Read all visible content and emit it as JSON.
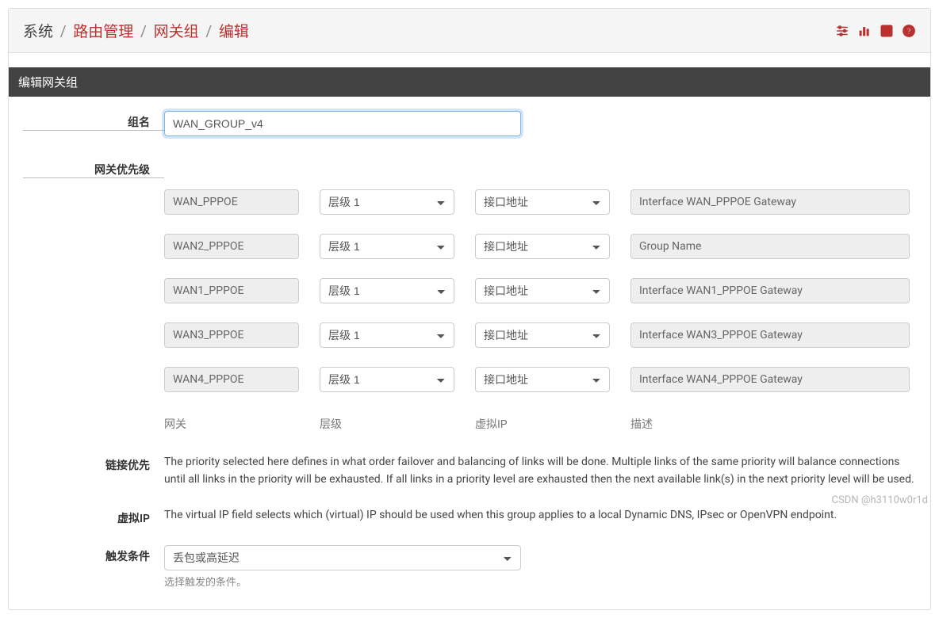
{
  "breadcrumb": {
    "root": "系统",
    "items": [
      "路由管理",
      "网关组",
      "编辑"
    ]
  },
  "header_icons": [
    "sliders-icon",
    "chart-icon",
    "list-icon",
    "help-icon"
  ],
  "panel": {
    "title": "编辑网关组",
    "group_name_label": "组名",
    "group_name_value": "WAN_GROUP_v4",
    "priority_label": "网关优先级",
    "link_priority_label": "链接优先",
    "virtual_ip_label": "虚拟IP",
    "trigger_label": "触发条件",
    "trigger_value": "丢包或高延迟",
    "trigger_hint": "选择触发的条件。",
    "link_priority_help": "The priority selected here defines in what order failover and balancing of links will be done. Multiple links of the same priority will balance connections until all links in the priority will be exhausted. If all links in a priority level are exhausted then the next available link(s) in the next priority level will be used.",
    "virtual_ip_help": "The virtual IP field selects which (virtual) IP should be used when this group applies to a local Dynamic DNS, IPsec or OpenVPN endpoint.",
    "column_labels": {
      "gateway": "网关",
      "tier": "层级",
      "vip": "虚拟IP",
      "desc": "描述"
    },
    "rows": [
      {
        "gateway": "WAN_PPPOE",
        "tier": "层级 1",
        "vip": "接口地址",
        "desc": "Interface WAN_PPPOE Gateway"
      },
      {
        "gateway": "WAN2_PPPOE",
        "tier": "层级 1",
        "vip": "接口地址",
        "desc": "Group Name"
      },
      {
        "gateway": "WAN1_PPPOE",
        "tier": "层级 1",
        "vip": "接口地址",
        "desc": "Interface WAN1_PPPOE Gateway"
      },
      {
        "gateway": "WAN3_PPPOE",
        "tier": "层级 1",
        "vip": "接口地址",
        "desc": "Interface WAN3_PPPOE Gateway"
      },
      {
        "gateway": "WAN4_PPPOE",
        "tier": "层级 1",
        "vip": "接口地址",
        "desc": "Interface WAN4_PPPOE Gateway"
      }
    ]
  },
  "watermark": "CSDN @h3110w0r1d"
}
